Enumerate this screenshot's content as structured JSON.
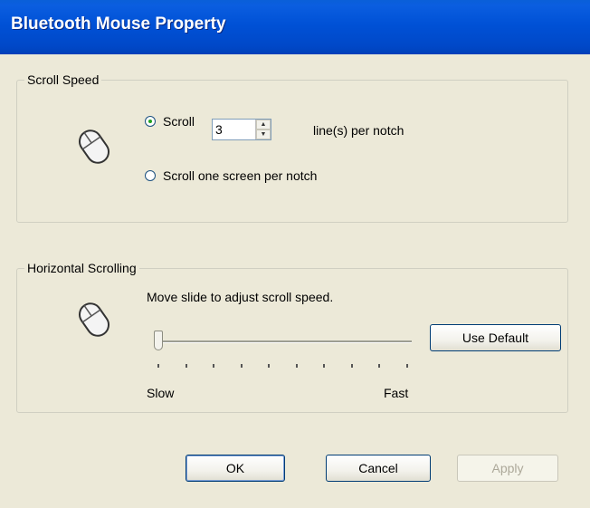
{
  "window": {
    "title": "Bluetooth Mouse Property"
  },
  "scroll_speed": {
    "group_label": "Scroll Speed",
    "option_lines_label": "Scroll",
    "lines_value": "3",
    "lines_suffix": "line(s) per notch",
    "option_screen_label": "Scroll one screen per notch",
    "selected": "lines"
  },
  "horizontal_scrolling": {
    "group_label": "Horizontal Scrolling",
    "instruction": "Move slide to adjust scroll speed.",
    "slow_label": "Slow",
    "fast_label": "Fast",
    "use_default_label": "Use Default",
    "slider_value_fraction": 0.0,
    "tick_count": 10
  },
  "buttons": {
    "ok": "OK",
    "cancel": "Cancel",
    "apply": "Apply"
  },
  "icons": {
    "mouse": "mouse-icon",
    "spin_up": "spin-up-icon",
    "spin_down": "spin-down-icon"
  },
  "colors": {
    "title_bar": "#0050d6",
    "dialog_bg": "#ece9d8",
    "radio_dot": "#21a121"
  }
}
